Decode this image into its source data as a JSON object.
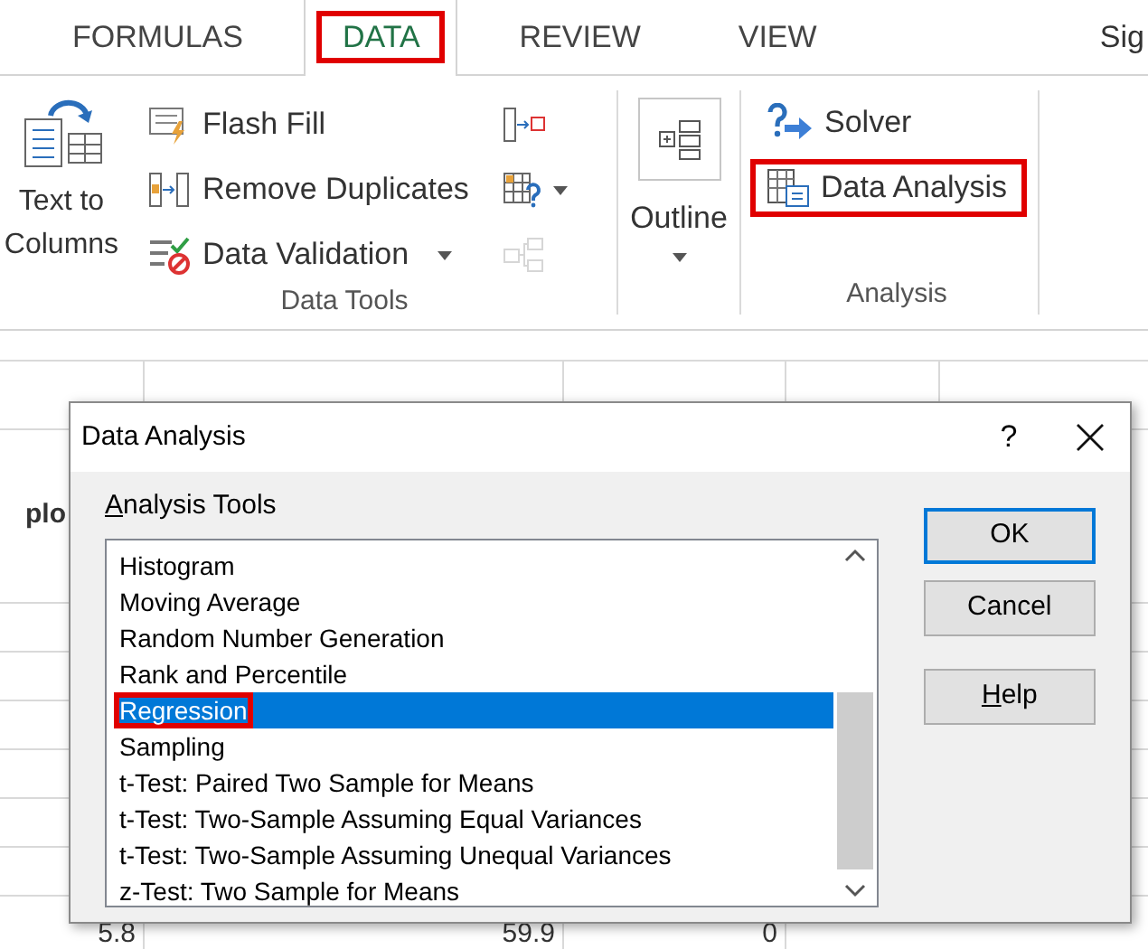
{
  "ribbon_tabs": [
    {
      "label": "FORMULAS",
      "selected": false,
      "highlighted": false
    },
    {
      "label": "DATA",
      "selected": true,
      "highlighted": true
    },
    {
      "label": "REVIEW",
      "selected": false,
      "highlighted": false
    },
    {
      "label": "VIEW",
      "selected": false,
      "highlighted": false
    }
  ],
  "account_link": "Sig",
  "ribbon": {
    "data_tools": {
      "label": "Data Tools",
      "large_button": {
        "label": "Text to Columns"
      },
      "commands": [
        {
          "kind": "flash-fill",
          "label": "Flash Fill",
          "dropdown": false
        },
        {
          "kind": "remove-duplicates",
          "label": "Remove Duplicates",
          "dropdown": false
        },
        {
          "kind": "data-validation",
          "label": "Data Validation",
          "dropdown": true
        }
      ],
      "icon_buttons": [
        {
          "kind": "consolidate",
          "dropdown": false,
          "disabled": false
        },
        {
          "kind": "what-if",
          "dropdown": true,
          "disabled": false
        },
        {
          "kind": "relationships",
          "dropdown": false,
          "disabled": true
        }
      ]
    },
    "outline": {
      "label": "Outline",
      "dropdown": true
    },
    "analysis": {
      "label": "Analysis",
      "commands": [
        {
          "kind": "solver",
          "label": "Solver",
          "highlighted": false
        },
        {
          "kind": "data-analysis",
          "label": "Data Analysis",
          "highlighted": true
        }
      ]
    }
  },
  "sheet": {
    "header_cell": "plo",
    "bottom_row": [
      "5.8",
      "59.9",
      "0"
    ]
  },
  "dialog": {
    "title": "Data Analysis",
    "help_glyph": "?",
    "list_label": {
      "label": "Analysis Tools",
      "accesskey_underlined": true
    },
    "items": [
      {
        "label": "Histogram",
        "selected": false,
        "highlighted": false
      },
      {
        "label": "Moving Average",
        "selected": false,
        "highlighted": false
      },
      {
        "label": "Random Number Generation",
        "selected": false,
        "highlighted": false
      },
      {
        "label": "Rank and Percentile",
        "selected": false,
        "highlighted": false
      },
      {
        "label": "Regression",
        "selected": true,
        "highlighted": true
      },
      {
        "label": "Sampling",
        "selected": false,
        "highlighted": false
      },
      {
        "label": "t-Test: Paired Two Sample for Means",
        "selected": false,
        "highlighted": false
      },
      {
        "label": "t-Test: Two-Sample Assuming Equal Variances",
        "selected": false,
        "highlighted": false
      },
      {
        "label": "t-Test: Two-Sample Assuming Unequal Variances",
        "selected": false,
        "highlighted": false
      },
      {
        "label": "z-Test: Two Sample for Means",
        "selected": false,
        "highlighted": false
      }
    ],
    "buttons": [
      {
        "label": "OK",
        "default": true,
        "accesskey_underlined": false
      },
      {
        "label": "Cancel",
        "default": false,
        "accesskey_underlined": false
      },
      {
        "label": "Help",
        "default": false,
        "accesskey_underlined": true
      }
    ]
  }
}
